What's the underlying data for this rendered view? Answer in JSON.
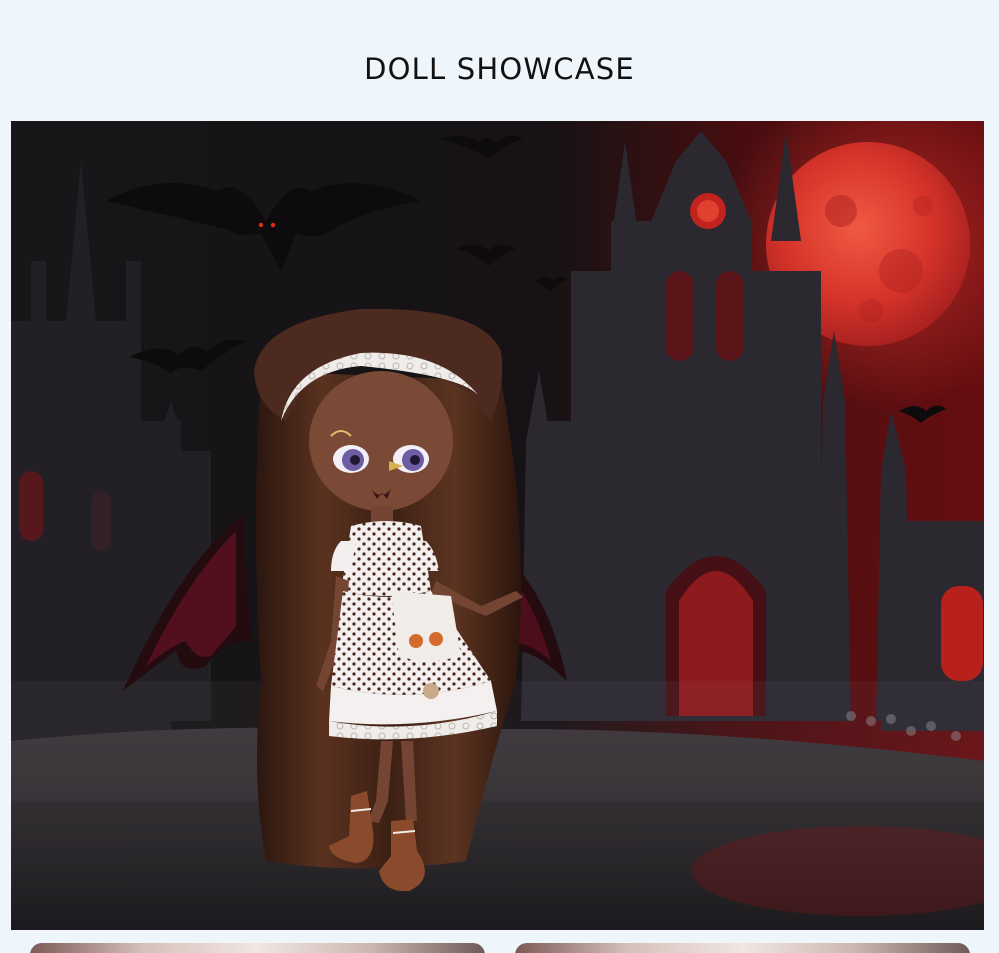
{
  "header": {
    "title": "DOLL SHOWCASE"
  },
  "hero": {
    "image_name": "gothic-vampire-doll-photo",
    "scene": "doll-in-front-of-gothic-cathedral-with-red-moon-and-bats",
    "colors": {
      "sky_dark": "#161417",
      "sky_red": "#8c1b1e",
      "moon": "#d8392a",
      "cathedral": "#2b2830",
      "ground": "#2d2a2e",
      "hair": "#4a2a1b",
      "skin": "#7a4a36",
      "dress_white": "#f0efee",
      "dress_brown": "#5b2d1b",
      "boots": "#8a4a2c",
      "wings": "#5e1020"
    }
  },
  "thumbnails": [
    {
      "name": "thumbnail-left"
    },
    {
      "name": "thumbnail-right"
    }
  ]
}
